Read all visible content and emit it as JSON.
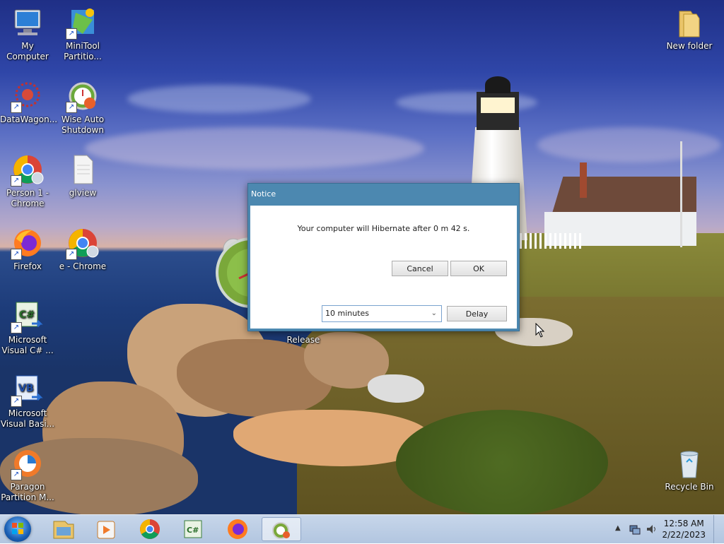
{
  "desktop": {
    "icons_left": [
      {
        "label": "My Computer"
      },
      {
        "label": "MiniTool Partitio..."
      },
      {
        "label": "DataWagon..."
      },
      {
        "label": "Wise Auto Shutdown"
      },
      {
        "label": "Person 1 - Chrome"
      },
      {
        "label": "glview"
      },
      {
        "label": "Firefox"
      },
      {
        "label": "e - Chrome"
      },
      {
        "label": "Microsoft Visual C# ..."
      },
      {
        "label": "Microsoft Visual Basi..."
      },
      {
        "label": "Paragon Partition M..."
      }
    ],
    "new_folder": "New folder",
    "recycle_bin": "Recycle Bin",
    "release_label": "Release"
  },
  "dialog": {
    "title": "Notice",
    "message": "Your computer will Hibernate after 0 m 42 s.",
    "cancel_label": "Cancel",
    "ok_label": "OK",
    "delay_option": "10 minutes",
    "delay_label": "Delay"
  },
  "taskbar": {
    "time": "12:58 AM",
    "date": "2/22/2023",
    "pinned": [
      "windows-explorer",
      "media-player",
      "chrome",
      "visual-csharp",
      "firefox",
      "wise-auto-shutdown"
    ]
  },
  "colors": {
    "dialog_title_bar": "#4c88b0",
    "taskbar": "#b9cbe3"
  }
}
